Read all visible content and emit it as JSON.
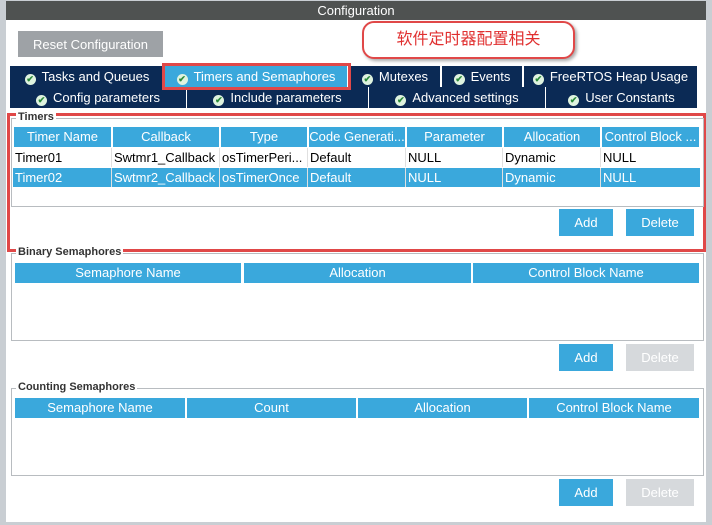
{
  "title": "Configuration",
  "reset_label": "Reset Configuration",
  "callout": "软件定时器配置相关",
  "tabs_row1": [
    "Tasks and Queues",
    "Timers and Semaphores",
    "Mutexes",
    "Events",
    "FreeRTOS Heap Usage"
  ],
  "tabs_row2": [
    "Config parameters",
    "Include parameters",
    "Advanced settings",
    "User Constants"
  ],
  "active_tab": "Timers and Semaphores",
  "timers": {
    "label": "Timers",
    "columns": [
      "Timer Name",
      "Callback",
      "Type",
      "Code Generati...",
      "Parameter",
      "Allocation",
      "Control Block ..."
    ],
    "rows": [
      [
        "Timer01",
        "Swtmr1_Callback",
        "osTimerPeri...",
        "Default",
        "NULL",
        "Dynamic",
        "NULL"
      ],
      [
        "Timer02",
        "Swtmr2_Callback",
        "osTimerOnce",
        "Default",
        "NULL",
        "Dynamic",
        "NULL"
      ]
    ],
    "selected_row": 1,
    "add": "Add",
    "delete": "Delete"
  },
  "binary": {
    "label": "Binary Semaphores",
    "columns": [
      "Semaphore Name",
      "Allocation",
      "Control Block Name"
    ],
    "add": "Add",
    "delete": "Delete"
  },
  "counting": {
    "label": "Counting Semaphores",
    "columns": [
      "Semaphore Name",
      "Count",
      "Allocation",
      "Control Block Name"
    ],
    "add": "Add",
    "delete": "Delete"
  },
  "colors": {
    "accent": "#3aa8dc",
    "tab_bg": "#0b2a55",
    "highlight": "#e04848"
  }
}
